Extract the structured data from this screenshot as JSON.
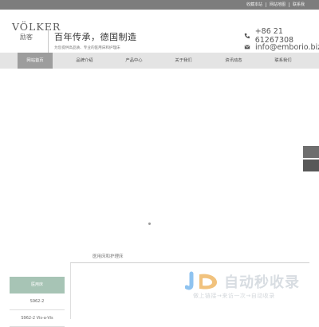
{
  "topbar": {
    "links": [
      "收藏本站",
      "网站地图",
      "联系我"
    ]
  },
  "brand": {
    "logo_word": "VÖLKER",
    "logo_cn": "励客",
    "slogan": "百年传承，德国制造",
    "subslogan": "为您提供高品质、专业的医用床和护理床"
  },
  "contact": {
    "phone": "+86 21 61267308",
    "email": "info@emborio.biz"
  },
  "nav": {
    "items": [
      "网站首页",
      "品牌介绍",
      "产品中心",
      "关于我们",
      "资讯动态",
      "联系我们"
    ]
  },
  "section": {
    "title": "医用床和护理床"
  },
  "sidebar": {
    "head": "医用床",
    "items": [
      "S962-2",
      "S962-2 Vis-a-Vis"
    ]
  },
  "watermark": {
    "logo_text": "JD",
    "title": "自动秒收录",
    "subtitle": "做上链接→来访一次→自动收录"
  },
  "colors": {
    "topbar": "#7d7d7d",
    "nav_bg": "#e4e4e4",
    "nav_active": "#9d9d9d",
    "sidebar_head": "#a7c4b5",
    "float_buttons": "#6e6e6e"
  }
}
